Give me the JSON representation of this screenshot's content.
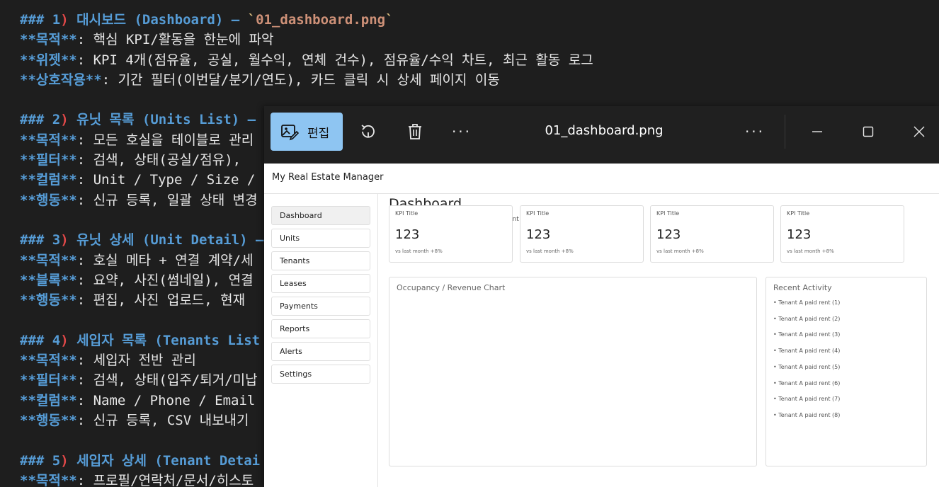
{
  "editor": {
    "lines": [
      [
        {
          "c": "hash",
          "t": "### "
        },
        {
          "c": "hnum",
          "t": "1"
        },
        {
          "c": "hparen",
          "t": ")"
        },
        {
          "c": "htext",
          "t": " 대시보드 (Dashboard) — "
        },
        {
          "c": "hcode-tick",
          "t": "`"
        },
        {
          "c": "hcode",
          "t": "01_dashboard.png"
        },
        {
          "c": "hcode-tick",
          "t": "`"
        }
      ],
      [
        {
          "c": "bold-label",
          "t": "**목적**"
        },
        {
          "c": "body-text",
          "t": ": 핵심 KPI/활동을 한눈에 파악"
        }
      ],
      [
        {
          "c": "bold-label",
          "t": "**위젯**"
        },
        {
          "c": "body-text",
          "t": ": KPI 4개(점유율, 공실, 월수익, 연체 건수), 점유율/수익 차트, 최근 활동 로그"
        }
      ],
      [
        {
          "c": "bold-label",
          "t": "**상호작용**"
        },
        {
          "c": "body-text",
          "t": ": 기간 필터(이번달/분기/연도), 카드 클릭 시 상세 페이지 이동"
        }
      ],
      [],
      [
        {
          "c": "hash",
          "t": "### "
        },
        {
          "c": "hnum",
          "t": "2"
        },
        {
          "c": "hparen",
          "t": ")"
        },
        {
          "c": "htext",
          "t": " 유닛 목록 (Units List) —"
        }
      ],
      [
        {
          "c": "bold-label",
          "t": "**목적**"
        },
        {
          "c": "body-text",
          "t": ": 모든 호실을 테이블로 관리"
        }
      ],
      [
        {
          "c": "bold-label",
          "t": "**필터**"
        },
        {
          "c": "body-text",
          "t": ": 검색, 상태(공실/점유),"
        }
      ],
      [
        {
          "c": "bold-label",
          "t": "**컬럼**"
        },
        {
          "c": "body-text",
          "t": ": Unit / Type / Size /"
        }
      ],
      [
        {
          "c": "bold-label",
          "t": "**행동**"
        },
        {
          "c": "body-text",
          "t": ": 신규 등록, 일괄 상태 변경"
        }
      ],
      [],
      [
        {
          "c": "hash",
          "t": "### "
        },
        {
          "c": "hnum",
          "t": "3"
        },
        {
          "c": "hparen",
          "t": ")"
        },
        {
          "c": "htext",
          "t": " 유닛 상세 (Unit Detail) —"
        }
      ],
      [
        {
          "c": "bold-label",
          "t": "**목적**"
        },
        {
          "c": "body-text",
          "t": ": 호실 메타 + 연결 계약/세"
        }
      ],
      [
        {
          "c": "bold-label",
          "t": "**블록**"
        },
        {
          "c": "body-text",
          "t": ": 요약, 사진(썸네일), 연결"
        }
      ],
      [
        {
          "c": "bold-label",
          "t": "**행동**"
        },
        {
          "c": "body-text",
          "t": ": 편집, 사진 업로드, 현재"
        }
      ],
      [],
      [
        {
          "c": "hash",
          "t": "### "
        },
        {
          "c": "hnum",
          "t": "4"
        },
        {
          "c": "hparen",
          "t": ")"
        },
        {
          "c": "htext",
          "t": " 세입자 목록 (Tenants List"
        }
      ],
      [
        {
          "c": "bold-label",
          "t": "**목적**"
        },
        {
          "c": "body-text",
          "t": ": 세입자 전반 관리"
        }
      ],
      [
        {
          "c": "bold-label",
          "t": "**필터**"
        },
        {
          "c": "body-text",
          "t": ": 검색, 상태(입주/퇴거/미납"
        }
      ],
      [
        {
          "c": "bold-label",
          "t": "**컬럼**"
        },
        {
          "c": "body-text",
          "t": ": Name / Phone / Email"
        }
      ],
      [
        {
          "c": "bold-label",
          "t": "**행동**"
        },
        {
          "c": "body-text",
          "t": ": 신규 등록, CSV 내보내기"
        }
      ],
      [],
      [
        {
          "c": "hash",
          "t": "### "
        },
        {
          "c": "hnum",
          "t": "5"
        },
        {
          "c": "hparen",
          "t": ")"
        },
        {
          "c": "htext",
          "t": " 세입자 상세 (Tenant Detai"
        }
      ],
      [
        {
          "c": "bold-label",
          "t": "**목적**"
        },
        {
          "c": "body-text",
          "t": ": 프로필/연락처/문서/히스토"
        }
      ]
    ]
  },
  "viewer": {
    "edit_label": "편집",
    "filename": "01_dashboard.png",
    "more_dots": "···"
  },
  "app": {
    "title": "My Real Estate Manager",
    "page_title": "Dashboard",
    "ghost_text": "ent",
    "nav": [
      "Dashboard",
      "Units",
      "Tenants",
      "Leases",
      "Payments",
      "Reports",
      "Alerts",
      "Settings"
    ],
    "active_nav": "Dashboard",
    "kpis": [
      {
        "title": "KPI Title",
        "value": "123",
        "delta": "vs last month +8%"
      },
      {
        "title": "KPI Title",
        "value": "123",
        "delta": "vs last month +8%"
      },
      {
        "title": "KPI Title",
        "value": "123",
        "delta": "vs last month +8%"
      },
      {
        "title": "KPI Title",
        "value": "123",
        "delta": "vs last month +8%"
      }
    ],
    "chart_title": "Occupancy / Revenue Chart",
    "activity_title": "Recent Activity",
    "activity": [
      "• Tenant A paid rent (1)",
      "• Tenant A paid rent (2)",
      "• Tenant A paid rent (3)",
      "• Tenant A paid rent (4)",
      "• Tenant A paid rent (5)",
      "• Tenant A paid rent (6)",
      "• Tenant A paid rent (7)",
      "• Tenant A paid rent (8)"
    ]
  },
  "icons": {
    "edit": "edit-image-icon",
    "rotate": "rotate-icon",
    "delete": "trash-icon",
    "more": "more-icon",
    "minimize": "minimize-icon",
    "maximize": "maximize-icon",
    "close": "close-icon"
  },
  "colors": {
    "editor_bg": "#1e1e1e",
    "heading": "#569cd6",
    "heading_paren": "#e04848",
    "code_span": "#ce9178",
    "edit_button_bg": "#8ec5f2",
    "viewer_bg": "#202020"
  }
}
